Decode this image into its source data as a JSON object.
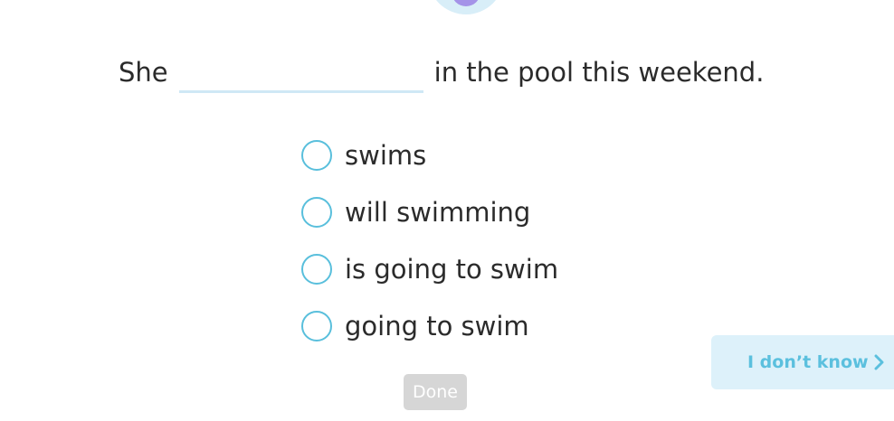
{
  "question": {
    "prefix": "She",
    "suffix": "in the pool this weekend."
  },
  "options": [
    {
      "label": "swims"
    },
    {
      "label": "will swimming"
    },
    {
      "label": "is going to swim"
    },
    {
      "label": "going to swim"
    }
  ],
  "actions": {
    "done_label": "Done",
    "idk_label": "I don’t know"
  },
  "icons": {
    "idk": "chevron-right-icon"
  },
  "colors": {
    "accent": "#59bfdc",
    "idk_bg": "#ddf1fa",
    "done_disabled_bg": "#d6d6d6",
    "avatar": "#a493e8"
  }
}
